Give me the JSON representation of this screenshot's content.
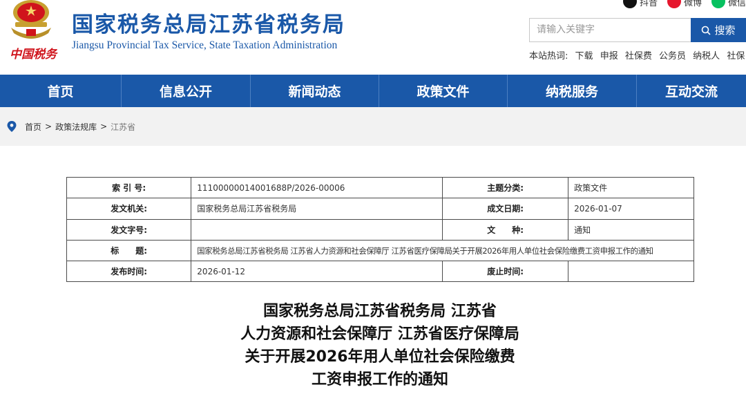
{
  "header": {
    "calligraphy": "中国税务",
    "title": "国家税务总局江苏省税务局",
    "subtitle": "Jiangsu Provincial Tax Service, State Taxation Administration",
    "social": [
      {
        "label": "抖音",
        "icon": "douyin-icon",
        "color": "#111111"
      },
      {
        "label": "微博",
        "icon": "weibo-icon",
        "color": "#e6162d"
      },
      {
        "label": "微信",
        "icon": "wechat-icon",
        "color": "#07c160"
      }
    ],
    "search": {
      "placeholder": "请输入关键字",
      "button_label": "搜索"
    },
    "hotwords_label": "本站热词:",
    "hotwords": [
      "下载",
      "申报",
      "社保费",
      "公务员",
      "纳税人",
      "社保"
    ]
  },
  "nav": {
    "items": [
      "首页",
      "信息公开",
      "新闻动态",
      "政策文件",
      "纳税服务",
      "互动交流"
    ]
  },
  "breadcrumb": {
    "items": [
      "首页",
      "政策法规库",
      "江苏省"
    ],
    "separator": ">"
  },
  "info": {
    "rows": [
      {
        "k1": "索 引 号:",
        "v1": "11100000014001688P/2026-00006",
        "k2": "主题分类:",
        "v2": "政策文件"
      },
      {
        "k1": "发文机关:",
        "v1": "国家税务总局江苏省税务局",
        "k2": "成文日期:",
        "v2": "2026-01-07"
      },
      {
        "k1": "发文字号:",
        "v1": "",
        "k2": "文　　种:",
        "v2": "通知"
      },
      {
        "k1": "标　　题:",
        "v1": "国家税务总局江苏省税务局 江苏省人力资源和社会保障厅 江苏省医疗保障局关于开展2026年用人单位社会保险缴费工资申报工作的通知"
      },
      {
        "k1": "发布时间:",
        "v1": "2026-01-12",
        "k2": "废止时间:",
        "v2": ""
      }
    ]
  },
  "article": {
    "title_lines": [
      "国家税务总局江苏省税务局 江苏省",
      "人力资源和社会保障厅 江苏省医疗保障局",
      "关于开展2026年用人单位社会保险缴费",
      "工资申报工作的通知"
    ]
  },
  "colors": {
    "brand_blue": "#1a58a8",
    "brand_red": "#d0141c",
    "crumb_bg": "#f2f2f2"
  }
}
